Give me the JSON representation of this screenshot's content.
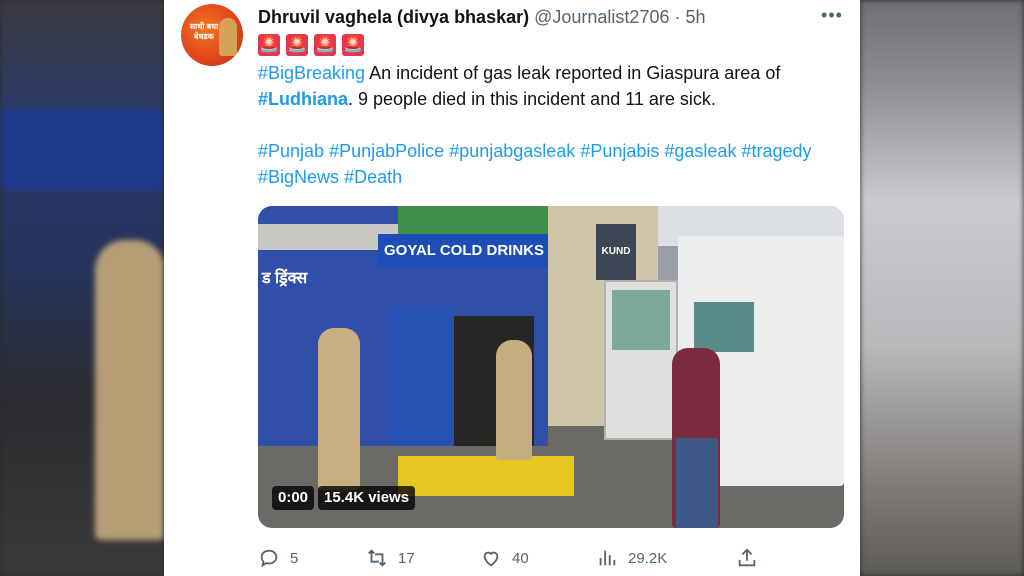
{
  "tweet": {
    "display_name": "Dhruvil vaghela (divya bhaskar)",
    "handle": "@Journalist2706",
    "separator": "·",
    "time": "5h",
    "more_icon": "more-horizontal-icon",
    "emojis": [
      "🚨",
      "🚨",
      "🚨",
      "🚨"
    ],
    "text": {
      "tag1": "#BigBreaking",
      "part1": " An incident of gas leak reported in Giaspura area of ",
      "tag2": "#Ludhiana",
      "part2": ". 9 people died in this incident and 11 are sick."
    },
    "hashtags": [
      "#Punjab",
      "#PunjabPolice",
      "#punjabgasleak",
      "#Punjabis",
      "#gasleak",
      "#tragedy",
      "#BigNews",
      "#Death"
    ],
    "avatar_text": "साथी बधा बेधडक"
  },
  "media": {
    "duration": "0:00",
    "views": "15.4K views",
    "sign_text": "GOYAL COLD DRINKS",
    "sign_hindi": "ड ड्रिंक्स",
    "dark_sign_text": "KUND"
  },
  "actions": {
    "reply_count": "5",
    "retweet_count": "17",
    "like_count": "40",
    "views_count": "29.2K"
  }
}
